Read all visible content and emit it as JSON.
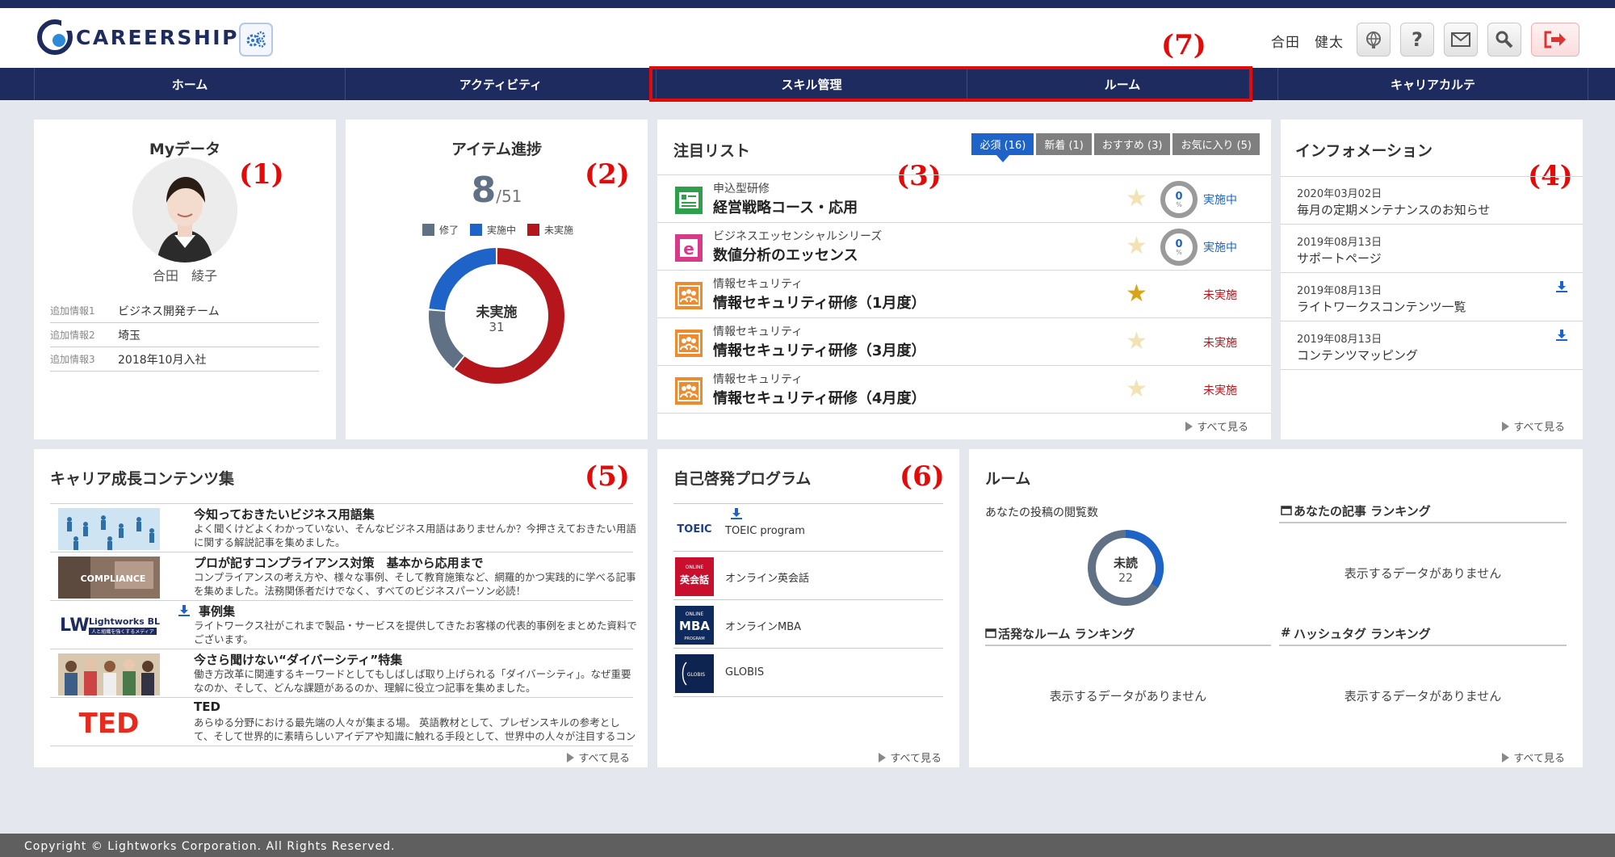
{
  "header": {
    "logo_text": "CAREERSHIP",
    "username": "合田　健太",
    "annotation": "(7)"
  },
  "nav": {
    "items": [
      "ホーム",
      "アクティビティ",
      "スキル管理",
      "ルーム",
      "キャリアカルテ"
    ]
  },
  "mydata": {
    "title": "Myデータ",
    "annotation": "(1)",
    "name": "合田　綾子",
    "info": [
      {
        "key": "追加情報1",
        "value": "ビジネス開発チーム"
      },
      {
        "key": "追加情報2",
        "value": "埼玉"
      },
      {
        "key": "追加情報3",
        "value": "2018年10月入社"
      }
    ]
  },
  "progress": {
    "title": "アイテム進捗",
    "annotation": "(2)",
    "done_count": "8",
    "total": "/51",
    "legend": [
      "修了",
      "実施中",
      "未実施"
    ],
    "donut_center_label": "未実施",
    "donut_center_value": "31",
    "segments": {
      "done": 8,
      "in_progress": 12,
      "not_started": 31
    },
    "colors": {
      "done": "#607085",
      "in_progress": "#1e64c8",
      "not_started": "#b5161c"
    }
  },
  "attention": {
    "title": "注目リスト",
    "annotation": "(3)",
    "tabs": [
      "必須 (16)",
      "新着 (1)",
      "おすすめ (3)",
      "お気に入り (5)"
    ],
    "items": [
      {
        "category": "申込型研修",
        "title": "経営戦略コース・応用",
        "icon": "form-icon",
        "starred": false,
        "percent": "0",
        "status": "実施中"
      },
      {
        "category": "ビジネスエッセンシャルシリーズ",
        "title": "数値分析のエッセンス",
        "icon": "elearning-icon",
        "starred": false,
        "percent": "0",
        "status": "実施中"
      },
      {
        "category": "情報セキュリティ",
        "title": "情報セキュリティ研修（1月度）",
        "icon": "group-training-icon",
        "starred": true,
        "status": "未実施"
      },
      {
        "category": "情報セキュリティ",
        "title": "情報セキュリティ研修（3月度）",
        "icon": "group-training-icon",
        "starred": false,
        "status": "未実施"
      },
      {
        "category": "情報セキュリティ",
        "title": "情報セキュリティ研修（4月度）",
        "icon": "group-training-icon",
        "starred": false,
        "status": "未実施"
      }
    ],
    "percent_unit": "%",
    "more": "すべて見る"
  },
  "info": {
    "title": "インフォメーション",
    "annotation": "(4)",
    "items": [
      {
        "date": "2020年03月02日",
        "title": "毎月の定期メンテナンスのお知らせ",
        "download": false
      },
      {
        "date": "2019年08月13日",
        "title": "サポートページ",
        "download": false
      },
      {
        "date": "2019年08月13日",
        "title": "ライトワークスコンテンツ一覧",
        "download": true
      },
      {
        "date": "2019年08月13日",
        "title": "コンテンツマッピング",
        "download": true
      }
    ],
    "more": "すべて見る"
  },
  "career": {
    "title": "キャリア成長コンテンツ集",
    "annotation": "(5)",
    "items": [
      {
        "title": "今知っておきたいビジネス用語集",
        "desc": "よく聞くけどよくわかっていない、そんなビジネス用語はありませんか？今押さえておきたい用語に関する解説記事を集めました。",
        "thumb": "business-people-illustration"
      },
      {
        "title": "プロが記すコンプライアンス対策　基本から応用まで",
        "desc": "コンプライアンスの考え方や、様々な事例、そして教育施策など、網羅的かつ実践的に学べる記事を集めました。法務関係者だけでなく、すべてのビジネスパーソン必読！",
        "thumb": "compliance-image",
        "thumb_text": "COMPLIANCE",
        "ellipsis": "…"
      },
      {
        "title": "事例集",
        "desc": "ライトワークス社がこれまで製品・サービスを提供してきたお客様の代表的事例をまとめた資料でございます。",
        "thumb": "lightworks-blog-logo",
        "thumb_text": "Lightworks BLOG",
        "thumb_sub": "人と組織を強くするメディア",
        "download": true
      },
      {
        "title": "今さら聞けない“ダイバーシティ”特集",
        "desc": "働き方改革に関連するキーワードとしてもしばしば取り上げられる「ダイバーシティ」。なぜ重要なのか、そして、どんな課題があるのか、理解に役立つ記事を集めました。",
        "thumb": "diverse-team-photo"
      },
      {
        "title": "TED",
        "desc": "あらゆる分野における最先端の人々が集まる場。 英語教材として、プレゼンスキルの参考として、そして世界的に素晴らしいアイデアや知識に触れる手段として、世界中の人々が注目するコンテ…",
        "thumb": "ted-logo",
        "thumb_text": "TED"
      }
    ],
    "more": "すべて見る"
  },
  "selfdev": {
    "title": "自己啓発プログラム",
    "annotation": "(6)",
    "items": [
      {
        "label": "TOEIC program",
        "logo_text": "TOEIC",
        "download": true
      },
      {
        "label": "オンライン英会話",
        "logo_text": "英会話",
        "logo_sub": "ONLINE"
      },
      {
        "label": "オンラインMBA",
        "logo_text": "MBA",
        "logo_sub": "ONLINE",
        "logo_sub2": "PROGRAM"
      },
      {
        "label": "GLOBIS",
        "logo_text": "GLOBIS"
      }
    ],
    "more": "すべて見る"
  },
  "room": {
    "title": "ルーム",
    "views_label": "あなたの投稿の閲覧数",
    "unread_label": "未読",
    "unread_value": "22",
    "article_ranking": "あなたの記事 ランキング",
    "active_room_ranking": "活発なルーム ランキング",
    "hashtag_ranking": "ハッシュタグ ランキング",
    "no_data": "表示するデータがありません",
    "more": "すべて見る"
  },
  "footer": {
    "copyright": "Copyright © Lightworks Corporation. All Rights Reserved."
  }
}
